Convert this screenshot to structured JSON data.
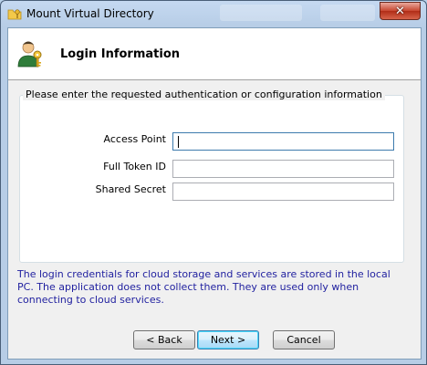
{
  "window": {
    "title": "Mount Virtual Directory",
    "close_glyph": "✕",
    "title_icon": "folder-key-icon"
  },
  "header": {
    "title": "Login Information",
    "icon": "user-key-icon"
  },
  "group": {
    "legend": "Please enter the requested authentication or configuration information"
  },
  "fields": {
    "access_point": {
      "label": "Access Point",
      "value": ""
    },
    "full_token_id": {
      "label": "Full Token ID",
      "value": ""
    },
    "shared_secret": {
      "label": "Shared Secret",
      "value": ""
    }
  },
  "info": {
    "text": "The login credentials for cloud storage and services are stored in the local PC. The application does not collect them. They are used only when connecting to cloud services."
  },
  "buttons": {
    "back": "< Back",
    "next": "Next >",
    "cancel": "Cancel"
  },
  "colors": {
    "info_text": "#1f1f9f",
    "close_button": "#c7452f",
    "frame": "#b9d1ea"
  }
}
